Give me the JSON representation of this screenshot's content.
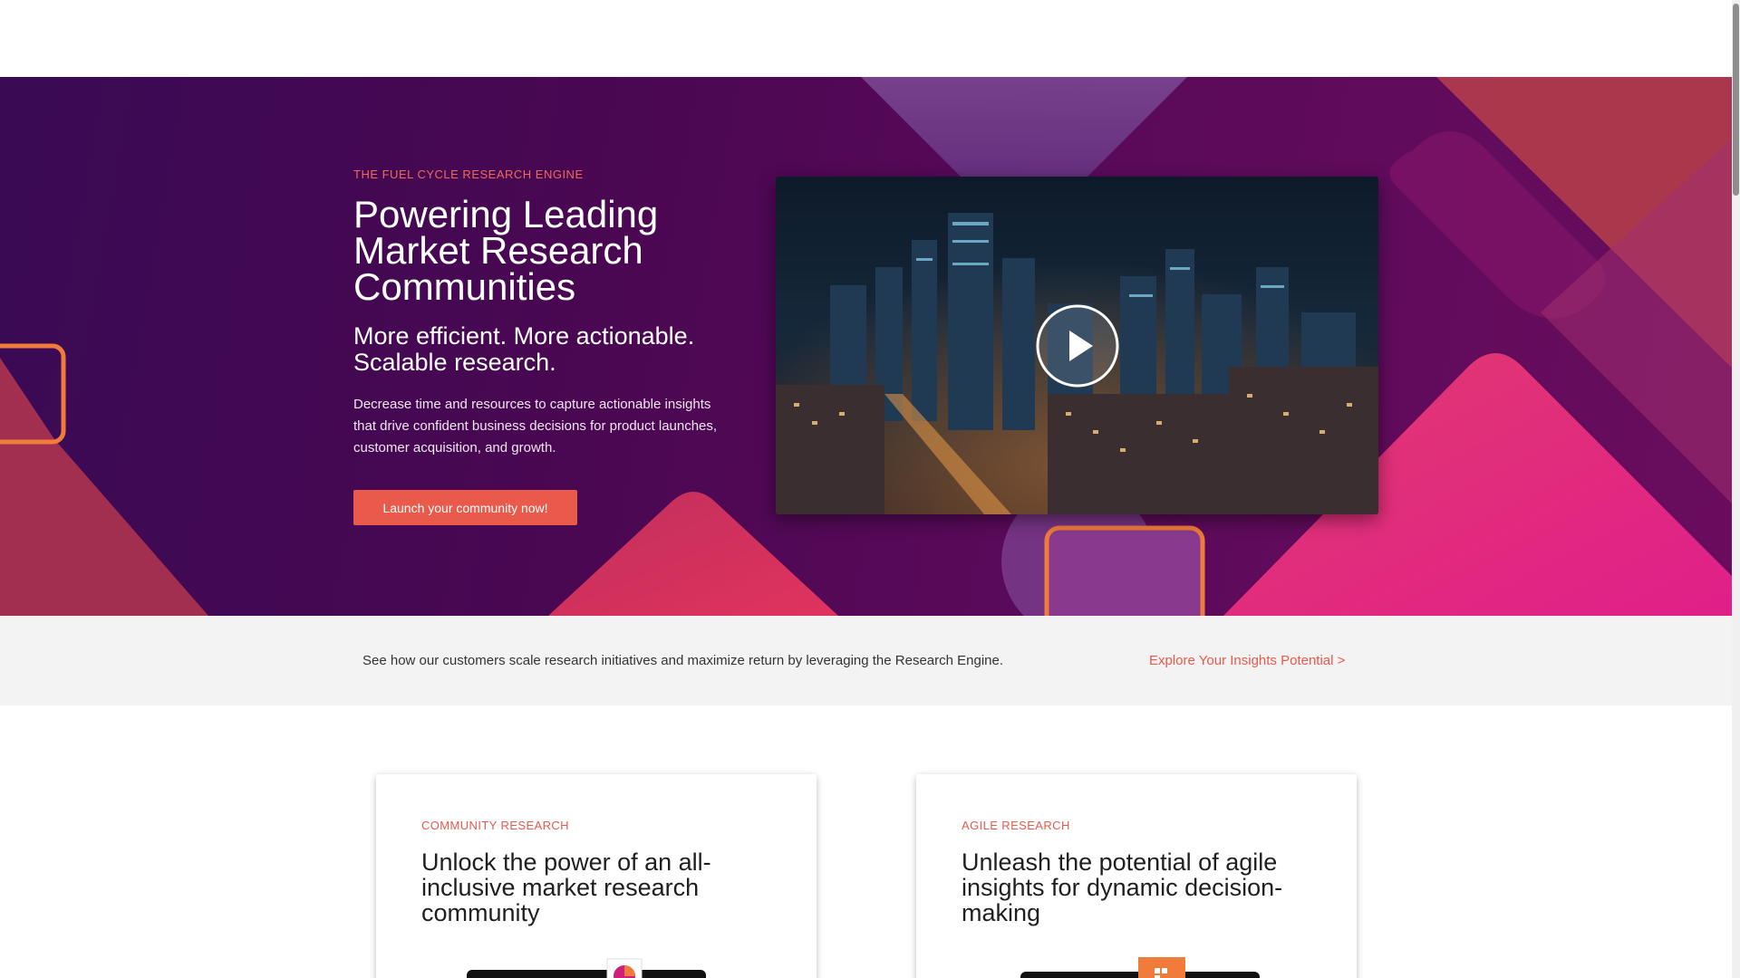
{
  "hero": {
    "eyebrow": "THE FUEL CYCLE RESEARCH ENGINE",
    "title": "Powering Leading Market Research Communities",
    "subtitle": "More efficient. More actionable. Scalable research.",
    "description": "Decrease time and resources to capture actionable insights that drive confident business decisions for product launches, customer acquisition, and growth.",
    "cta_label": "Launch your community now!"
  },
  "video": {
    "icon": "play-icon"
  },
  "strip": {
    "text": "See how our customers scale research initiatives and maximize return by leveraging the Research Engine.",
    "link": "Explore Your Insights Potential >"
  },
  "cards": [
    {
      "eyebrow": "COMMUNITY RESEARCH",
      "title": "Unlock the power of an all-inclusive market research community"
    },
    {
      "eyebrow": "AGILE RESEARCH",
      "title": "Unleash the potential of agile insights for dynamic decision-making"
    }
  ],
  "colors": {
    "accent": "#e95a4b",
    "hero_bg": "#4a0752",
    "orange": "#f07b3a",
    "magenta": "#d01f7a"
  }
}
